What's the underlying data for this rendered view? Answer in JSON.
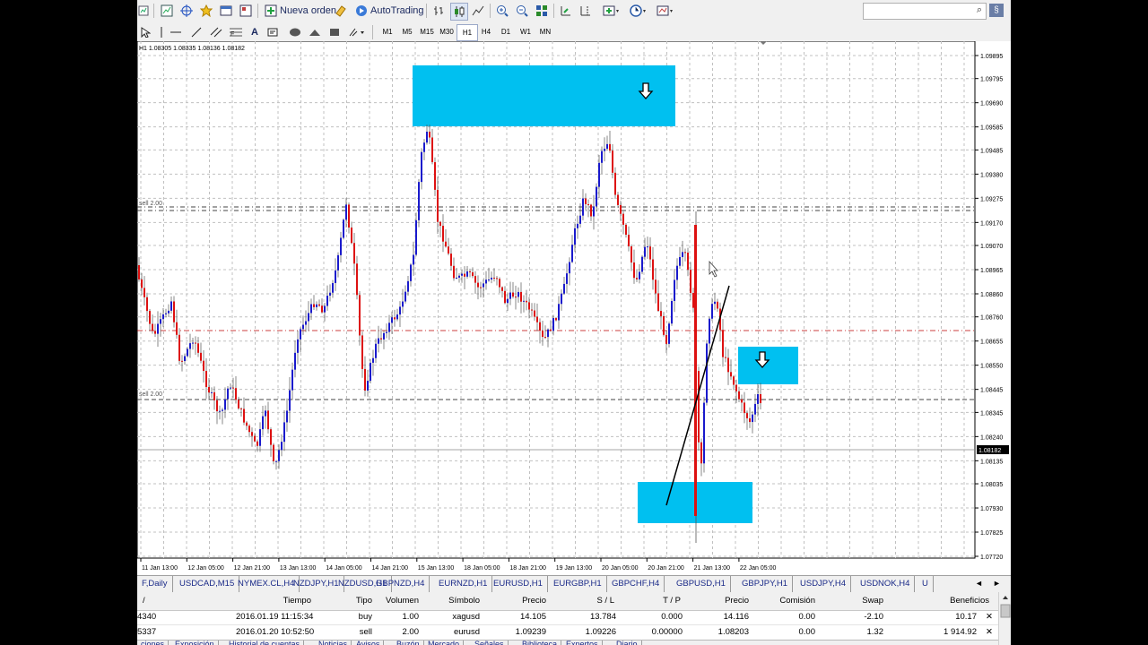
{
  "toolbar": {
    "new_order_label": "Nueva orden",
    "autotrading_label": "AutoTrading",
    "search_placeholder": "",
    "timeframes": [
      "M1",
      "M5",
      "M15",
      "M30",
      "H1",
      "H4",
      "D1",
      "W1",
      "MN"
    ],
    "active_timeframe": "H1",
    "text_tool_label": "A",
    "icons": [
      "new-chart-icon",
      "profiles-icon",
      "crosshair-icon",
      "favorites-icon",
      "market-watch-icon",
      "navigator-icon",
      "new-order-icon",
      "metaeditor-icon",
      "autotrading-icon",
      "bar-chart-icon",
      "candles-icon",
      "line-chart-icon",
      "zoom-in-icon",
      "zoom-out-icon",
      "tile-windows-icon",
      "autoscroll-icon",
      "chart-shift-icon",
      "indicators-icon",
      "periods-icon",
      "templates-icon",
      "cursor-icon",
      "vertical-line-icon",
      "horizontal-line-icon",
      "trend-line-icon",
      "equidistant-channel-icon",
      "fibonacci-icon",
      "text-icon",
      "text-label-icon",
      "ellipse-icon",
      "triangle-icon",
      "rectangle-icon",
      "more-objects-icon"
    ]
  },
  "chart": {
    "header": "H1  1.08305 1.08335 1.08136 1.08182",
    "current_price": "1.08182",
    "order_labels": [
      "sell 2.00",
      "sell 2.00"
    ],
    "price_levels": [
      "1.09895",
      "1.09795",
      "1.09690",
      "1.09585",
      "1.09485",
      "1.09380",
      "1.09275",
      "1.09170",
      "1.09070",
      "1.08965",
      "1.08860",
      "1.08760",
      "1.08655",
      "1.08550",
      "1.08445",
      "1.08345",
      "1.08240",
      "1.08135",
      "1.08035",
      "1.07930",
      "1.07825",
      "1.07720"
    ],
    "time_labels": [
      "11 Jan 13:00",
      "12 Jan 05:00",
      "12 Jan 21:00",
      "13 Jan 13:00",
      "14 Jan 05:00",
      "14 Jan 21:00",
      "15 Jan 13:00",
      "18 Jan 05:00",
      "18 Jan 21:00",
      "19 Jan 13:00",
      "20 Jan 05:00",
      "20 Jan 21:00",
      "21 Jan 13:00",
      "22 Jan 05:00"
    ],
    "colors": {
      "bull": "#1a1acc",
      "bear": "#dd1111",
      "zone": "#00c0f0",
      "grid": "#c0c0c0",
      "background": "#ffffff"
    },
    "zones": [
      "supply-zone-top",
      "supply-zone-right",
      "demand-zone-bottom"
    ]
  },
  "symbol_tabs": [
    "F,Daily",
    "USDCAD,M15",
    "NYMEX.CL,H4",
    "NZDJPY,H1",
    "NZDUSD,H1",
    "GBPNZD,H4",
    "EURNZD,H1",
    "EURUSD,H1",
    "EURGBP,H1",
    "GBPCHF,H4",
    "GBPUSD,H1",
    "GBPJPY,H1",
    "USDJPY,H4",
    "USDNOK,H4",
    "U"
  ],
  "terminal": {
    "columns": {
      "order": "/",
      "time": "Tiempo",
      "type": "Tipo",
      "volume": "Volumen",
      "symbol": "Símbolo",
      "price": "Precio",
      "sl": "S / L",
      "tp": "T / P",
      "current": "Precio",
      "commission": "Comisión",
      "swap": "Swap",
      "profit": "Beneficios"
    },
    "rows": [
      {
        "order": "4340",
        "time": "2016.01.19 11:15:34",
        "type": "buy",
        "volume": "1.00",
        "symbol": "xagusd",
        "price": "14.105",
        "sl": "13.784",
        "tp": "0.000",
        "current": "14.116",
        "commission": "0.00",
        "swap": "-2.10",
        "profit": "10.17"
      },
      {
        "order": "5337",
        "time": "2016.01.20 10:52:50",
        "type": "sell",
        "volume": "2.00",
        "symbol": "eurusd",
        "price": "1.09239",
        "sl": "1.09226",
        "tp": "0.00000",
        "current": "1.08203",
        "commission": "0.00",
        "swap": "1.32",
        "profit": "1 914.92"
      }
    ],
    "bottom_tabs": [
      "ciones",
      "Exposición",
      "Historial de cuentas",
      "Noticias",
      "Avisos",
      "Buzón",
      "Mercado",
      "Señales",
      "Biblioteca",
      "Expertos",
      "Diario"
    ]
  }
}
